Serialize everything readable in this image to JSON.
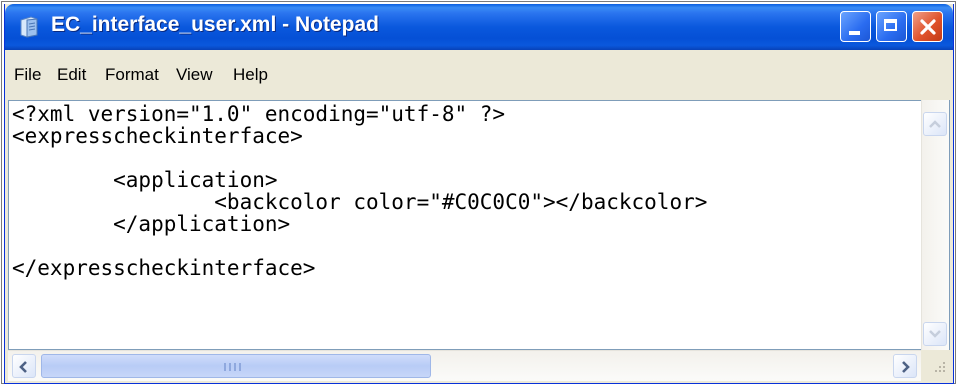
{
  "window": {
    "title": "EC_interface_user.xml - Notepad",
    "icon": "notepad-icon",
    "controls": [
      "minimize-icon",
      "maximize-icon",
      "close-icon"
    ]
  },
  "menu": {
    "items": [
      "File",
      "Edit",
      "Format",
      "View",
      "Help"
    ]
  },
  "editor": {
    "lines": [
      "<?xml version=\"1.0\" encoding=\"utf-8\" ?>",
      "<expresscheckinterface>",
      "",
      "        <application>",
      "                <backcolor color=\"#C0C0C0\"></backcolor>",
      "        </application>",
      "",
      "</expresscheckinterface>"
    ]
  },
  "colors": {
    "titlebar": "#0a58dd",
    "close_button": "#e0532c",
    "window_chrome": "#ece9d8"
  }
}
